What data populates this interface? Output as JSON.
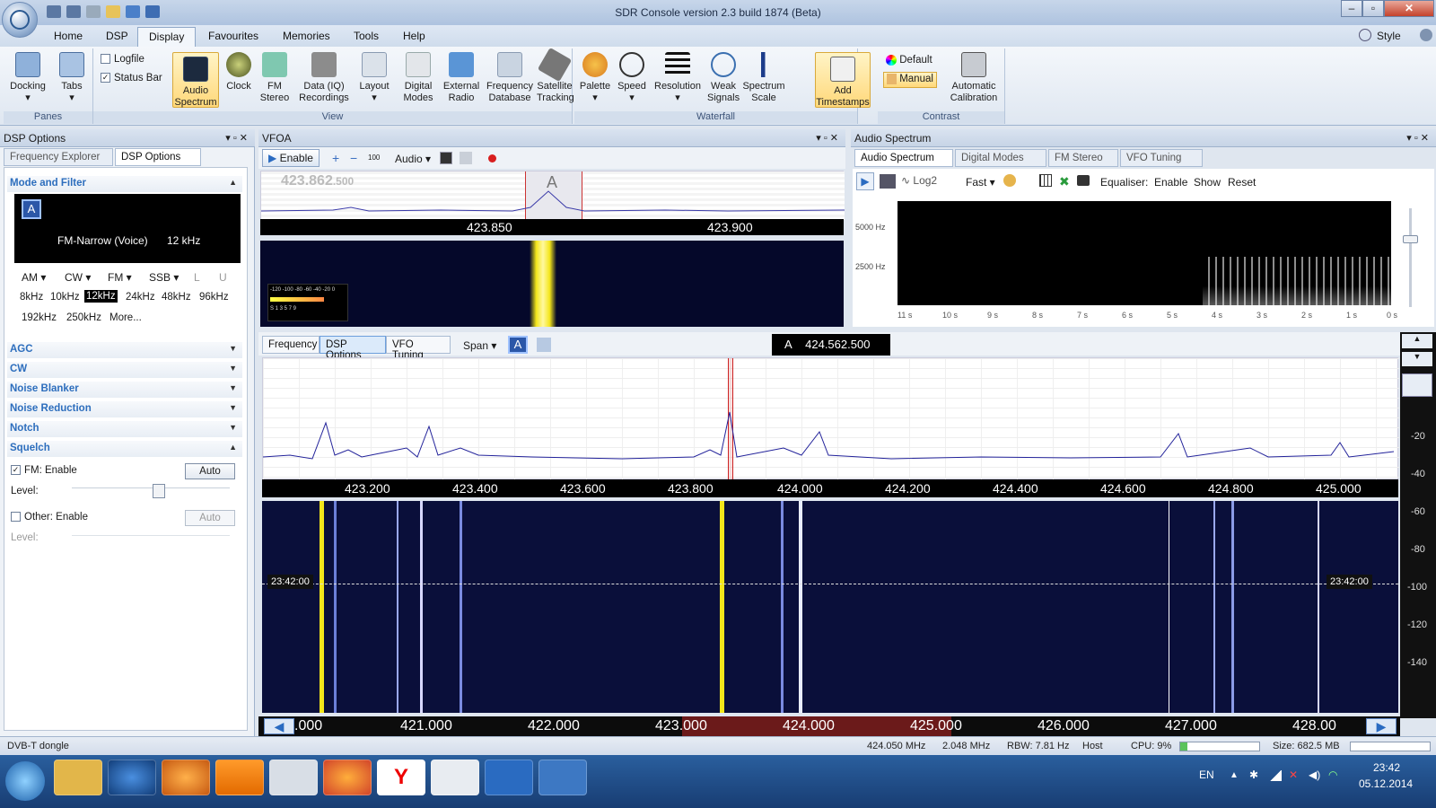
{
  "window": {
    "title": "SDR Console version 2.3 build 1874 (Beta)",
    "style_label": "Style"
  },
  "menu": {
    "tabs": [
      "Home",
      "DSP",
      "Display",
      "Favourites",
      "Memories",
      "Tools",
      "Help"
    ],
    "active": "Display"
  },
  "ribbon": {
    "panes": {
      "label": "Panes",
      "docking": "Docking",
      "tabs": "Tabs"
    },
    "view": {
      "label": "View",
      "logfile": "Logfile",
      "status_bar": "Status Bar",
      "audio_spectrum": "Audio Spectrum",
      "clock": "Clock",
      "fm_stereo": "FM Stereo",
      "data_iq": "Data (IQ) Recordings",
      "layout": "Layout",
      "digital_modes": "Digital Modes",
      "external_radio": "External Radio",
      "frequency_database": "Frequency Database",
      "satellite_tracking": "Satellite Tracking"
    },
    "waterfall": {
      "label": "Waterfall",
      "palette": "Palette",
      "speed": "Speed",
      "resolution": "Resolution",
      "weak_signals": "Weak Signals",
      "spectrum_scale": "Spectrum Scale",
      "add_timestamps": "Add Timestamps"
    },
    "contrast": {
      "label": "Contrast",
      "default": "Default",
      "manual": "Manual",
      "automatic_calibration": "Automatic Calibration"
    }
  },
  "dsp_panel": {
    "title": "DSP Options",
    "tab_frequency_explorer": "Frequency Explorer",
    "tab_dsp_options": "DSP Options",
    "mode_and_filter": "Mode and Filter",
    "vfo_letter": "A",
    "mode_display": "FM-Narrow (Voice)",
    "bandwidth_display": "12 kHz",
    "modes": [
      "AM",
      "CW",
      "FM",
      "SSB",
      "L",
      "U"
    ],
    "filters_row1": [
      "8kHz",
      "10kHz",
      "12kHz",
      "24kHz",
      "48kHz",
      "96kHz"
    ],
    "filters_row2": [
      "192kHz",
      "250kHz",
      "More..."
    ],
    "selected_filter": "12kHz",
    "sections": [
      "AGC",
      "CW",
      "Noise Blanker",
      "Noise Reduction",
      "Notch",
      "Squelch"
    ],
    "fm_enable": "FM: Enable",
    "auto": "Auto",
    "level": "Level:",
    "other_enable": "Other: Enable"
  },
  "vfo_panel": {
    "title": "VFOA",
    "enable": "Enable",
    "step": "100",
    "audio": "Audio",
    "freq_display": "423.862",
    "freq_display_suffix": ".500",
    "vfo_marker": "A",
    "tick_left": "423.850",
    "tick_right": "423.900",
    "smeter_scale": "-120 -100 -80 -60 -40 -20 0",
    "smeter_units": "S 1 3 5 7 9"
  },
  "audio_panel": {
    "title": "Audio Spectrum",
    "tabs": [
      "Audio Spectrum",
      "Digital Modes",
      "FM Stereo",
      "VFO Tuning"
    ],
    "log2": "Log2",
    "fast": "Fast",
    "equaliser": "Equaliser:",
    "enable": "Enable",
    "show": "Show",
    "reset": "Reset",
    "y_labels": [
      "5000 Hz",
      "2500 Hz"
    ],
    "x_labels": [
      "11 s",
      "10 s",
      "9 s",
      "8 s",
      "7 s",
      "6 s",
      "5 s",
      "4 s",
      "3 s",
      "2 s",
      "1 s",
      "0 s"
    ]
  },
  "main_spectrum": {
    "tabs": [
      "Frequency",
      "DSP Options",
      "VFO Tuning",
      "Span"
    ],
    "vfo_badge": "A",
    "vfo_letter": "A",
    "vfo_freq": "424.562.500",
    "ticks": [
      "423.200",
      "423.400",
      "423.600",
      "423.800",
      "424.000",
      "424.200",
      "424.400",
      "424.600",
      "424.800",
      "425.000"
    ],
    "timestamp": "23:42:00",
    "db_scale": [
      "-20",
      "-40",
      "-60",
      "-80",
      "-100",
      "-120",
      "-140"
    ],
    "band_ticks": [
      ".000",
      "421.000",
      "422.000",
      "423.000",
      "424.000",
      "425.000",
      "426.000",
      "427.000",
      "428.00"
    ]
  },
  "status": {
    "device": "DVB-T dongle",
    "frequency": "424.050 MHz",
    "bandwidth": "2.048 MHz",
    "rbw": "RBW: 7.81 Hz",
    "host": "Host",
    "cpu": "CPU: 9%",
    "size": "Size: 682.5 MB",
    "cpu_fraction": 0.09
  },
  "taskbar": {
    "language": "EN",
    "time": "23:42",
    "date": "05.12.2014"
  },
  "colors": {
    "accent": "#2d6ebd",
    "spectrum_bg": "#0a0f3a",
    "signal": "#f4e61a",
    "trace": "#22229a"
  }
}
